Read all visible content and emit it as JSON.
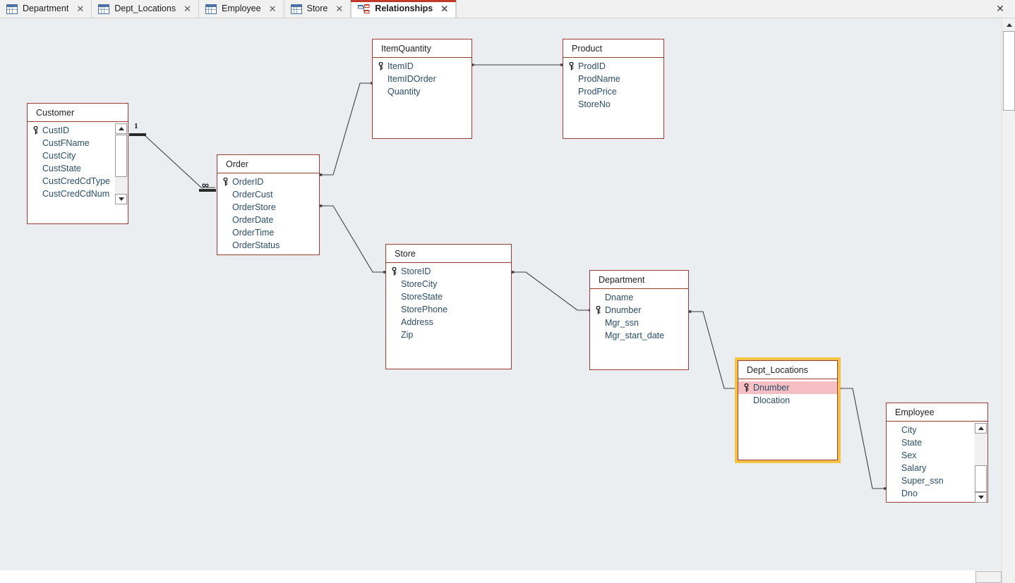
{
  "window": {
    "close_label": "✕"
  },
  "tabs": [
    {
      "label": "Department",
      "icon": "datasheet-icon",
      "active": false,
      "close_label": "✕"
    },
    {
      "label": "Dept_Locations",
      "icon": "datasheet-icon",
      "active": false,
      "close_label": "✕"
    },
    {
      "label": "Employee",
      "icon": "datasheet-icon",
      "active": false,
      "close_label": "✕"
    },
    {
      "label": "Store",
      "icon": "datasheet-icon",
      "active": false,
      "close_label": "✕"
    },
    {
      "label": "Relationships",
      "icon": "relationships-icon",
      "active": true,
      "close_label": "✕"
    }
  ],
  "colors": {
    "canvas": "#eaeef1",
    "table_border": "#9b3b35",
    "field_text": "#2b4d69",
    "selection": "#f5c344",
    "row_highlight": "#f6bfc3",
    "tab_accent": "#c0392b"
  },
  "diagram": {
    "tables": [
      {
        "name": "Customer",
        "fields": [
          {
            "label": "CustID",
            "pk": true,
            "highlight": false
          },
          {
            "label": "CustFName",
            "pk": false,
            "highlight": false
          },
          {
            "label": "CustCity",
            "pk": false,
            "highlight": false
          },
          {
            "label": "CustState",
            "pk": false,
            "highlight": false
          },
          {
            "label": "CustCredCdType",
            "pk": false,
            "highlight": false
          },
          {
            "label": "CustCredCdNum",
            "pk": false,
            "highlight": false
          }
        ],
        "scrollbar": true,
        "selected": false
      },
      {
        "name": "Order",
        "fields": [
          {
            "label": "OrderID",
            "pk": true,
            "highlight": false
          },
          {
            "label": "OrderCust",
            "pk": false,
            "highlight": false
          },
          {
            "label": "OrderStore",
            "pk": false,
            "highlight": false
          },
          {
            "label": "OrderDate",
            "pk": false,
            "highlight": false
          },
          {
            "label": "OrderTime",
            "pk": false,
            "highlight": false
          },
          {
            "label": "OrderStatus",
            "pk": false,
            "highlight": false
          }
        ],
        "scrollbar": false,
        "selected": false
      },
      {
        "name": "ItemQuantity",
        "fields": [
          {
            "label": "ItemID",
            "pk": true,
            "highlight": false
          },
          {
            "label": "ItemIDOrder",
            "pk": false,
            "highlight": false
          },
          {
            "label": "Quantity",
            "pk": false,
            "highlight": false
          }
        ],
        "scrollbar": false,
        "selected": false
      },
      {
        "name": "Product",
        "fields": [
          {
            "label": "ProdID",
            "pk": true,
            "highlight": false
          },
          {
            "label": "ProdName",
            "pk": false,
            "highlight": false
          },
          {
            "label": "ProdPrice",
            "pk": false,
            "highlight": false
          },
          {
            "label": "StoreNo",
            "pk": false,
            "highlight": false
          }
        ],
        "scrollbar": false,
        "selected": false
      },
      {
        "name": "Store",
        "fields": [
          {
            "label": "StoreID",
            "pk": true,
            "highlight": false
          },
          {
            "label": "StoreCity",
            "pk": false,
            "highlight": false
          },
          {
            "label": "StoreState",
            "pk": false,
            "highlight": false
          },
          {
            "label": "StorePhone",
            "pk": false,
            "highlight": false
          },
          {
            "label": "Address",
            "pk": false,
            "highlight": false
          },
          {
            "label": "Zip",
            "pk": false,
            "highlight": false
          }
        ],
        "scrollbar": false,
        "selected": false
      },
      {
        "name": "Department",
        "fields": [
          {
            "label": "Dname",
            "pk": false,
            "highlight": false
          },
          {
            "label": "Dnumber",
            "pk": true,
            "highlight": false
          },
          {
            "label": "Mgr_ssn",
            "pk": false,
            "highlight": false
          },
          {
            "label": "Mgr_start_date",
            "pk": false,
            "highlight": false
          }
        ],
        "scrollbar": false,
        "selected": false
      },
      {
        "name": "Dept_Locations",
        "fields": [
          {
            "label": "Dnumber",
            "pk": true,
            "highlight": true
          },
          {
            "label": "Dlocation",
            "pk": false,
            "highlight": false
          }
        ],
        "scrollbar": false,
        "selected": true
      },
      {
        "name": "Employee",
        "fields": [
          {
            "label": "City",
            "pk": false,
            "highlight": false
          },
          {
            "label": "State",
            "pk": false,
            "highlight": false
          },
          {
            "label": "Sex",
            "pk": false,
            "highlight": false
          },
          {
            "label": "Salary",
            "pk": false,
            "highlight": false
          },
          {
            "label": "Super_ssn",
            "pk": false,
            "highlight": false
          },
          {
            "label": "Dno",
            "pk": false,
            "highlight": false
          }
        ],
        "scrollbar": true,
        "selected": false
      }
    ],
    "relationship_labels": {
      "one": "1",
      "many": "∞"
    },
    "relationships": [
      {
        "from": "Customer",
        "to": "Order",
        "cardinality": "one-to-many"
      },
      {
        "from": "Order",
        "to": "ItemQuantity",
        "cardinality": "unspecified"
      },
      {
        "from": "ItemQuantity",
        "to": "Product",
        "cardinality": "unspecified"
      },
      {
        "from": "Order",
        "to": "Store",
        "cardinality": "unspecified"
      },
      {
        "from": "Store",
        "to": "Department",
        "cardinality": "unspecified"
      },
      {
        "from": "Department",
        "to": "Dept_Locations",
        "cardinality": "unspecified"
      },
      {
        "from": "Dept_Locations",
        "to": "Employee",
        "cardinality": "unspecified"
      }
    ]
  }
}
